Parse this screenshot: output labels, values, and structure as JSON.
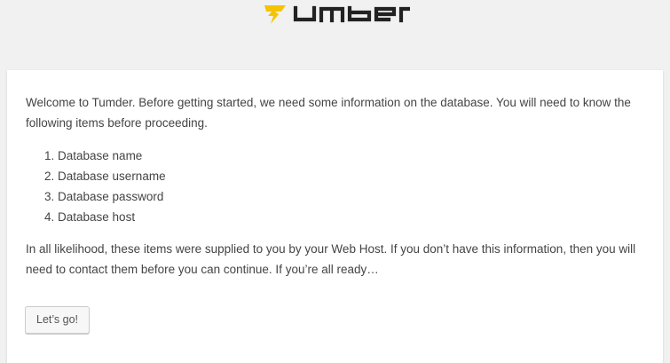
{
  "brand": {
    "logo_text": "Tumder",
    "accent_color": "#f5c400",
    "wordmark_color": "#222222"
  },
  "setup": {
    "intro": "Welcome to Tumder. Before getting started, we need some information on the database. You will need to know the following items before proceeding.",
    "items": [
      "1. Database name",
      "2. Database username",
      "3. Database password",
      "4. Database host"
    ],
    "outro": "In all likelihood, these items were supplied to you by your Web Host. If you don’t have this information, then you will need to contact them before you can continue. If you’re all ready…",
    "button_label": "Let’s go!"
  }
}
